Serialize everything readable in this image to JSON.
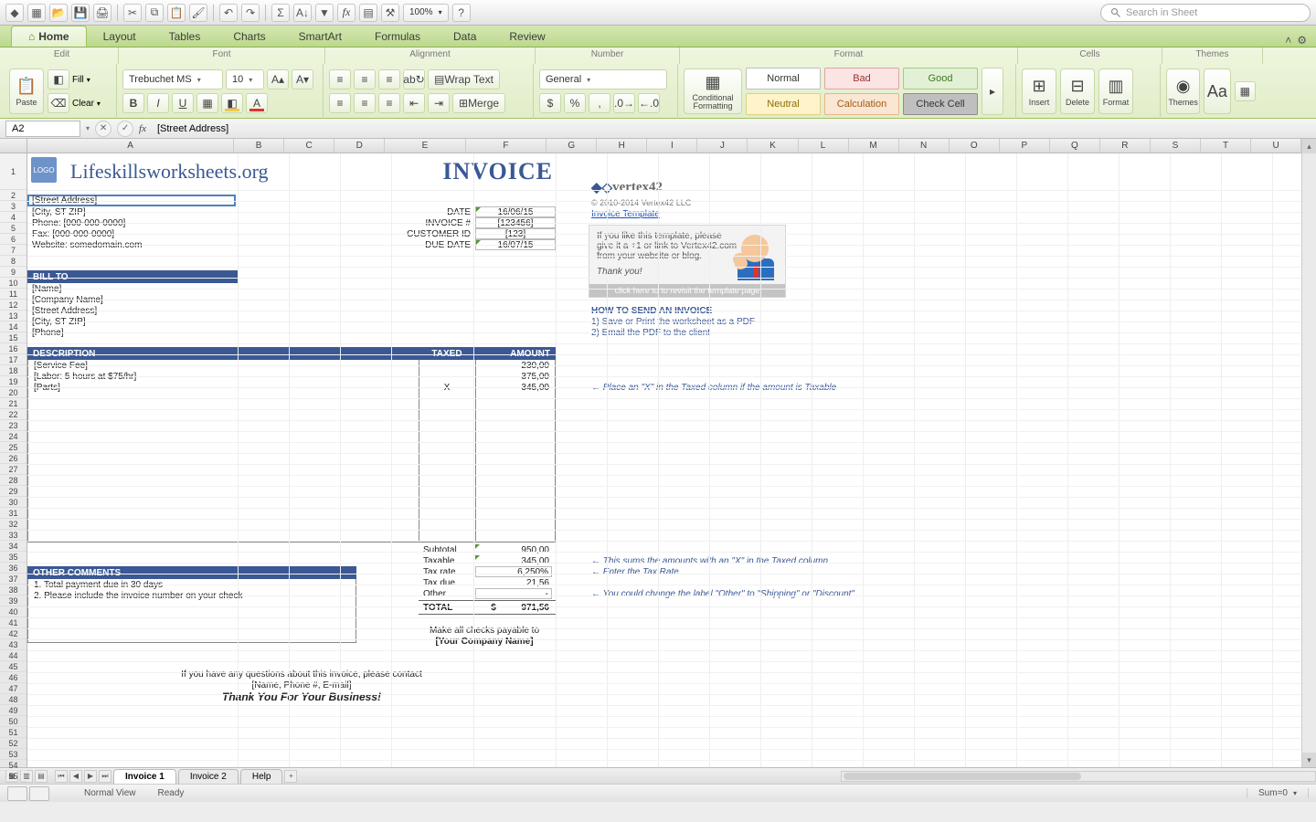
{
  "search_placeholder": "Search in Sheet",
  "zoom": "100%",
  "tabs": [
    "Home",
    "Layout",
    "Tables",
    "Charts",
    "SmartArt",
    "Formulas",
    "Data",
    "Review"
  ],
  "groups": [
    "Edit",
    "Font",
    "Alignment",
    "Number",
    "Format",
    "Cells",
    "Themes"
  ],
  "edit": {
    "fill": "Fill",
    "clear": "Clear",
    "paste": "Paste"
  },
  "font": {
    "name": "Trebuchet MS",
    "size": "10"
  },
  "align": {
    "wrap": "Wrap Text",
    "merge": "Merge"
  },
  "number": {
    "fmt": "General"
  },
  "styles": {
    "normal": "Normal",
    "bad": "Bad",
    "good": "Good",
    "neutral": "Neutral",
    "calc": "Calculation",
    "check": "Check Cell"
  },
  "cond_fmt": "Conditional Formatting",
  "cell_btns": {
    "insert": "Insert",
    "delete": "Delete",
    "format": "Format"
  },
  "theme_btns": {
    "themes": "Themes",
    "aa": "Aa"
  },
  "name_box": "A2",
  "formula": "[Street Address]",
  "columns": [
    "A",
    "B",
    "C",
    "D",
    "E",
    "F",
    "G",
    "H",
    "I",
    "J",
    "K",
    "L",
    "M",
    "N",
    "O",
    "P",
    "Q",
    "R",
    "S",
    "T",
    "U"
  ],
  "logo": "LOGO",
  "brand": "Lifeskillsworksheets.org",
  "inv_title": "INVOICE",
  "company_lines": [
    "[Street Address]",
    "[City, ST  ZIP]",
    "Phone: [000-000-0000]",
    "Fax: [000-000-0000]",
    "Website: somedomain.com"
  ],
  "meta_labels": [
    "DATE",
    "INVOICE #",
    "CUSTOMER ID",
    "DUE DATE"
  ],
  "meta_values": [
    "16/06/15",
    "[123456]",
    "[123]",
    "16/07/15"
  ],
  "bill_to": "BILL TO",
  "bill_lines": [
    "[Name]",
    "[Company Name]",
    "[Street Address]",
    "[City, ST  ZIP]",
    "[Phone]"
  ],
  "col_desc": "DESCRIPTION",
  "col_tax": "TAXED",
  "col_amt": "AMOUNT",
  "items": [
    {
      "d": "[Service Fee]",
      "t": "",
      "a": "230,00"
    },
    {
      "d": "[Labor: 5 hours at $75/hr]",
      "t": "",
      "a": "375,00"
    },
    {
      "d": "[Parts]",
      "t": "X",
      "a": "345,00"
    }
  ],
  "tot_labels": [
    "Subtotal",
    "Taxable",
    "Tax rate",
    "Tax due",
    "Other",
    "TOTAL"
  ],
  "tot_values": [
    "950,00",
    "345,00",
    "6,250%",
    "21,56",
    "-",
    ""
  ],
  "total_cur": "$",
  "total_val": "971,56",
  "other_comments": "OTHER COMMENTS",
  "comments": [
    "1. Total payment due in 30 days",
    "2. Please include the invoice number on your check"
  ],
  "payable": "Make all checks payable to",
  "payable_name": "[Your Company Name]",
  "questions": "If you have any questions about this invoice, please contact",
  "contact": "[Name, Phone #, E-mail]",
  "thanks": "Thank You For Your Business!",
  "v42": "vertex42",
  "v42_copy": "© 2010-2014 Vertex42 LLC",
  "v42_link": "Invoice Template",
  "promo": {
    "l1": "If you like this template, please",
    "l2": "give it a +1 or link to Vertex42.com",
    "l3": "from your website or blog.",
    "ty": "Thank you!",
    "bar": "click here to to revisit the template page"
  },
  "howto_h": "HOW TO SEND AN INVOICE",
  "howto_1": "1) Save or Print the worksheet as a PDF",
  "howto_2": "2) Email the PDF to the client",
  "hint_tax": "← Place an \"X\" in the Taxed column if the amount is Taxable",
  "hint_taxable": "← This sums the amounts with an \"X\" in the Taxed column",
  "hint_rate": "← Enter the Tax Rate",
  "hint_other": "← You could change the label \"Other\" to \"Shipping\" or \"Discount\"",
  "sheet_tabs": [
    "Invoice 1",
    "Invoice 2",
    "Help"
  ],
  "status": {
    "view": "Normal View",
    "ready": "Ready",
    "sum": "Sum=0"
  }
}
